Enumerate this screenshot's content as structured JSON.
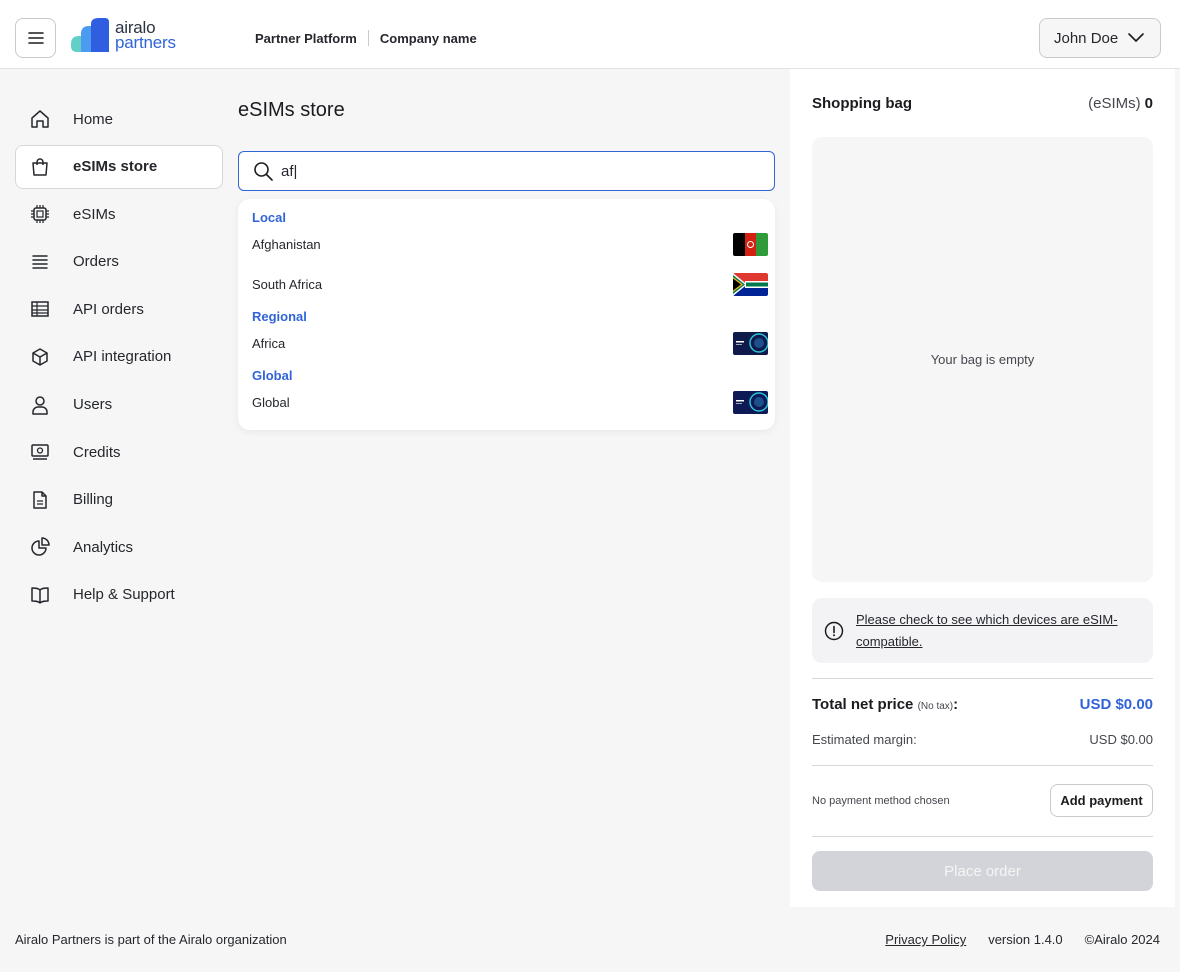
{
  "header": {
    "logo_line1": "airalo",
    "logo_line2": "partners",
    "platform": "Partner Platform",
    "company": "Company name",
    "user": "John Doe"
  },
  "sidebar": {
    "items": [
      {
        "label": "Home",
        "icon": "home-icon"
      },
      {
        "label": "eSIMs store",
        "icon": "shopping-bag-icon",
        "active": true
      },
      {
        "label": "eSIMs",
        "icon": "chip-icon"
      },
      {
        "label": "Orders",
        "icon": "orders-icon"
      },
      {
        "label": "API orders",
        "icon": "table-icon"
      },
      {
        "label": "API integration",
        "icon": "cube-icon"
      },
      {
        "label": "Users",
        "icon": "user-icon"
      },
      {
        "label": "Credits",
        "icon": "cash-icon"
      },
      {
        "label": "Billing",
        "icon": "document-icon"
      },
      {
        "label": "Analytics",
        "icon": "pie-chart-icon"
      },
      {
        "label": "Help & Support",
        "icon": "book-icon"
      }
    ]
  },
  "main": {
    "title": "eSIMs store",
    "search": {
      "value": "af|"
    },
    "dropdown": {
      "local_label": "Local",
      "local": [
        "Afghanistan",
        "South Africa"
      ],
      "regional_label": "Regional",
      "regional": [
        "Africa"
      ],
      "global_label": "Global",
      "global": [
        "Global"
      ]
    }
  },
  "bag": {
    "title": "Shopping bag",
    "count_label": "(eSIMs)",
    "count": "0",
    "empty": "Your bag is empty",
    "notice": "Please check to see which devices are eSIM-compatible.",
    "total_label": "Total net price",
    "total_note": "(No tax)",
    "total_value": "USD $0.00",
    "margin_label": "Estimated margin:",
    "margin_value": "USD $0.00",
    "payment_status": "No payment method chosen",
    "add_payment": "Add payment",
    "place_order": "Place order"
  },
  "footer": {
    "left": "Airalo Partners is part of the Airalo organization",
    "privacy": "Privacy Policy",
    "version": "version 1.4.0",
    "copyright": "©Airalo 2024"
  },
  "colors": {
    "accent": "#3064d8",
    "background": "#f6f6f7",
    "disabled_button": "#d3d4d9"
  }
}
